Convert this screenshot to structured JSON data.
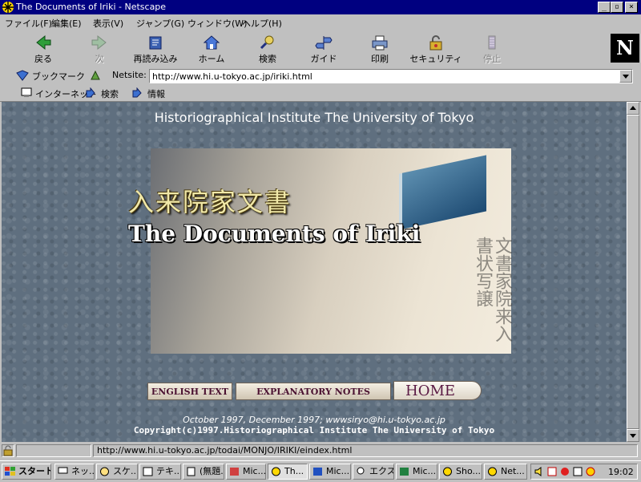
{
  "window": {
    "title": "The Documents of Iriki - Netscape",
    "buttons": {
      "minimize": "_",
      "maximize": "▫",
      "close": "×"
    }
  },
  "menu": [
    "ファイル(F)",
    "編集(E)",
    "表示(V)",
    "ジャンプ(G)",
    "ウィンドウ(W)",
    "ヘルプ(H)"
  ],
  "toolbar": {
    "items": [
      {
        "label": "戻る",
        "icon": "back-arrow-icon",
        "enabled": true
      },
      {
        "label": "次",
        "icon": "forward-arrow-icon",
        "enabled": false
      },
      {
        "label": "再読み込み",
        "icon": "reload-icon",
        "enabled": true
      },
      {
        "label": "ホーム",
        "icon": "home-icon",
        "enabled": true
      },
      {
        "label": "検索",
        "icon": "search-icon",
        "enabled": true
      },
      {
        "label": "ガイド",
        "icon": "guide-icon",
        "enabled": true
      },
      {
        "label": "印刷",
        "icon": "print-icon",
        "enabled": true
      },
      {
        "label": "セキュリティ",
        "icon": "security-lock-icon",
        "enabled": true
      },
      {
        "label": "停止",
        "icon": "stop-icon",
        "enabled": false
      }
    ],
    "logo": "N"
  },
  "location": {
    "bookmarks_label": "ブックマーク",
    "field_label": "Netsite:",
    "url": "http://www.hi.u-tokyo.ac.jp/iriki.html"
  },
  "personal_toolbar": [
    "インターネット",
    "検索",
    "情報"
  ],
  "page": {
    "header": "Historiographical Institute The University of Tokyo",
    "title_jp": "入来院家文書",
    "title_en": "The Documents of Iriki",
    "nav": {
      "english_text": "ENGLISH TEXT",
      "explanatory_notes": "EXPLANATORY NOTES",
      "home": "HOME"
    },
    "footer_dates": "October 1997, December 1997; wwwsiryo@hi.u-tokyo.ac.jp",
    "copyright": "Copyright(c)1997.Historiographical Institute The University of Tokyo"
  },
  "status_bar": {
    "text": "http://www.hi.u-tokyo.ac.jp/todai/MONJO/IRIKI/eindex.html"
  },
  "taskbar": {
    "start": "スタート",
    "tasks": [
      "ネッ...",
      "スケ...",
      "テキ...",
      "(無題...",
      "Mic...",
      "Th...",
      "Mic...",
      "エクス...",
      "Mic...",
      "Sho...",
      "Net..."
    ],
    "active_index": 5,
    "clock": "19:02"
  },
  "colors": {
    "titlebar": "#000080",
    "desktop_gray": "#c0c0c0",
    "page_background": "#5f6f7f",
    "nav_text": "#4a1030"
  }
}
